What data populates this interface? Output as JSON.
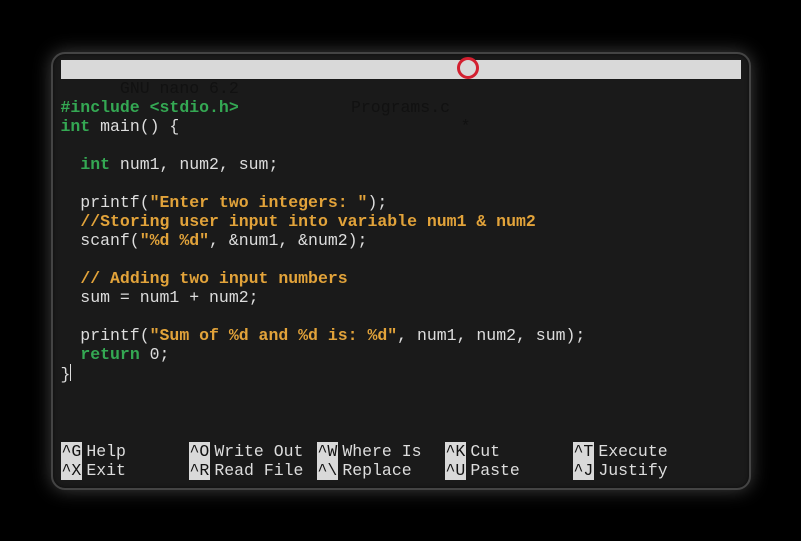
{
  "header": {
    "app": "  GNU nano 6.2",
    "filename": "Programs.c",
    "modified_indicator": "*"
  },
  "code": {
    "l1_include": "#include",
    "l1_path": " <stdio.h>",
    "l2_int": "int",
    "l2_rest": " main() {",
    "l3": "",
    "l4_pad": "  ",
    "l4_int": "int",
    "l4_rest": " num1, num2, sum;",
    "l5": "",
    "l6_pad": "  printf(",
    "l6_str": "\"Enter two integers: \"",
    "l6_rest": ");",
    "l7_pad": "  ",
    "l7_comment": "//Storing user input into variable num1 & num2",
    "l8_pad": "  scanf(",
    "l8_str": "\"%d %d\"",
    "l8_rest": ", &num1, &num2);",
    "l9": "",
    "l10_pad": "  ",
    "l10_comment": "// Adding two input numbers",
    "l11": "  sum = num1 + num2;",
    "l12": "",
    "l13_pad": "  printf(",
    "l13_str": "\"Sum of %d and %d is: %d\"",
    "l13_rest": ", num1, num2, sum);",
    "l14_pad": "  ",
    "l14_return": "return",
    "l14_rest": " 0;",
    "l15": "}"
  },
  "shortcuts": {
    "row1": [
      {
        "key": "^G",
        "label": "Help"
      },
      {
        "key": "^O",
        "label": "Write Out"
      },
      {
        "key": "^W",
        "label": "Where Is"
      },
      {
        "key": "^K",
        "label": "Cut"
      },
      {
        "key": "^T",
        "label": "Execute"
      }
    ],
    "row2": [
      {
        "key": "^X",
        "label": "Exit"
      },
      {
        "key": "^R",
        "label": "Read File"
      },
      {
        "key": "^\\",
        "label": "Replace"
      },
      {
        "key": "^U",
        "label": "Paste"
      },
      {
        "key": "^J",
        "label": "Justify"
      }
    ]
  }
}
